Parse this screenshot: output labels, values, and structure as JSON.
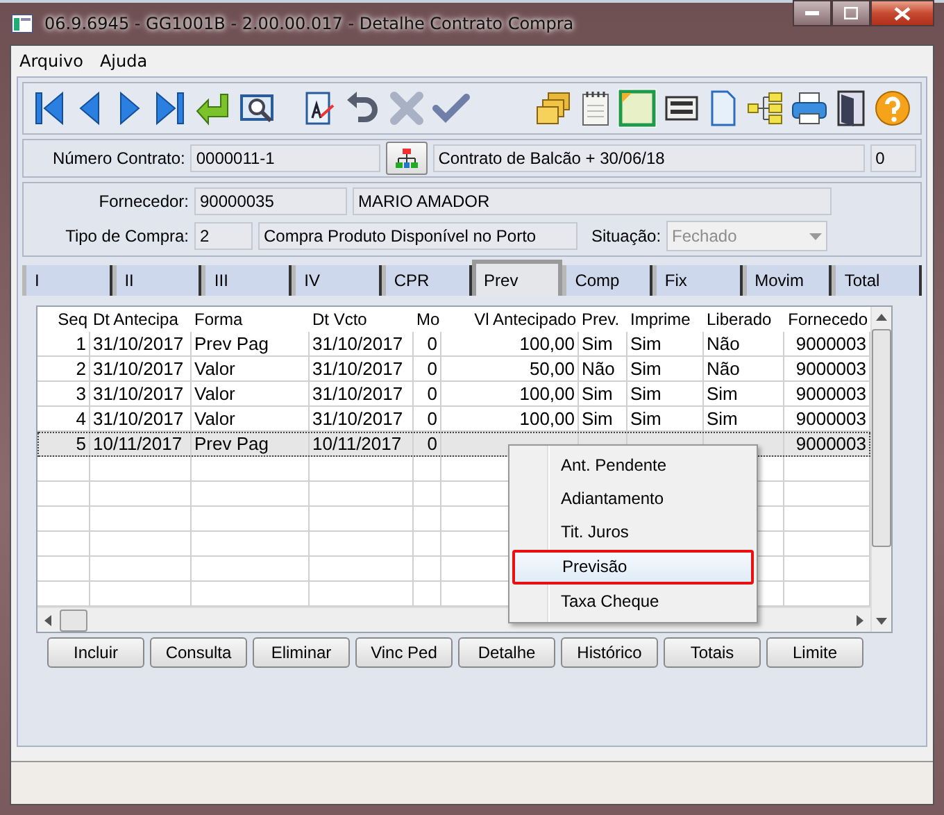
{
  "window": {
    "title": "06.9.6945 - GG1001B - 2.00.00.017 - Detalhe Contrato Compra"
  },
  "menu": [
    {
      "label": "Arquivo"
    },
    {
      "label": "Ajuda"
    }
  ],
  "contract": {
    "label": "Número Contrato:",
    "number": "0000011-1",
    "description": "Contrato de Balcão + 30/06/18",
    "count": "0"
  },
  "supplier": {
    "label": "Fornecedor:",
    "code": "90000035",
    "name": "MARIO AMADOR"
  },
  "purchase_type": {
    "label": "Tipo de Compra:",
    "code": "2",
    "description": "Compra Produto Disponível no Porto"
  },
  "status": {
    "label": "Situação:",
    "value": "Fechado",
    "disabled": true
  },
  "tabs": [
    {
      "label": "I",
      "selected": false
    },
    {
      "label": "II",
      "selected": false
    },
    {
      "label": "III",
      "selected": false
    },
    {
      "label": "IV",
      "selected": false
    },
    {
      "label": "CPR",
      "selected": false
    },
    {
      "label": "Prev",
      "selected": true
    },
    {
      "label": "Comp",
      "selected": false
    },
    {
      "label": "Fix",
      "selected": false
    },
    {
      "label": "Movim",
      "selected": false
    },
    {
      "label": "Total",
      "selected": false
    }
  ],
  "table": {
    "columns": [
      "Seq",
      "Dt Antecipa",
      "Forma",
      "Dt Vcto",
      "Mo",
      "Vl Antecipado",
      "Prev.",
      "Imprime",
      "Liberado",
      "Fornecedo"
    ],
    "rows": [
      {
        "cells": [
          "1",
          "31/10/2017",
          "Prev Pag",
          "31/10/2017",
          "0",
          "100,00",
          "Sim",
          "Sim",
          "Não",
          "9000003"
        ],
        "selected": false
      },
      {
        "cells": [
          "2",
          "31/10/2017",
          "Valor",
          "31/10/2017",
          "0",
          "50,00",
          "Não",
          "Sim",
          "Não",
          "9000003"
        ],
        "selected": false
      },
      {
        "cells": [
          "3",
          "31/10/2017",
          "Valor",
          "31/10/2017",
          "0",
          "100,00",
          "Sim",
          "Sim",
          "Sim",
          "9000003"
        ],
        "selected": false
      },
      {
        "cells": [
          "4",
          "31/10/2017",
          "Valor",
          "31/10/2017",
          "0",
          "100,00",
          "Sim",
          "Sim",
          "Sim",
          "9000003"
        ],
        "selected": false
      },
      {
        "cells": [
          "5",
          "10/11/2017",
          "Prev Pag",
          "10/11/2017",
          "0",
          null,
          null,
          null,
          null,
          "9000003"
        ],
        "selected": true
      }
    ]
  },
  "context_menu": {
    "items": [
      {
        "label": "Ant. Pendente",
        "selected": false
      },
      {
        "label": "Adiantamento",
        "selected": false
      },
      {
        "label": "Tit. Juros",
        "selected": false
      },
      {
        "label": "Previsão",
        "selected": true
      },
      {
        "label": "Taxa Cheque",
        "selected": false
      }
    ]
  },
  "buttons": [
    {
      "label": "Incluir"
    },
    {
      "label": "Consulta"
    },
    {
      "label": "Eliminar"
    },
    {
      "label": "Vinc Ped"
    },
    {
      "label": "Detalhe"
    },
    {
      "label": "Histórico"
    },
    {
      "label": "Totais"
    },
    {
      "label": "Limite"
    }
  ]
}
